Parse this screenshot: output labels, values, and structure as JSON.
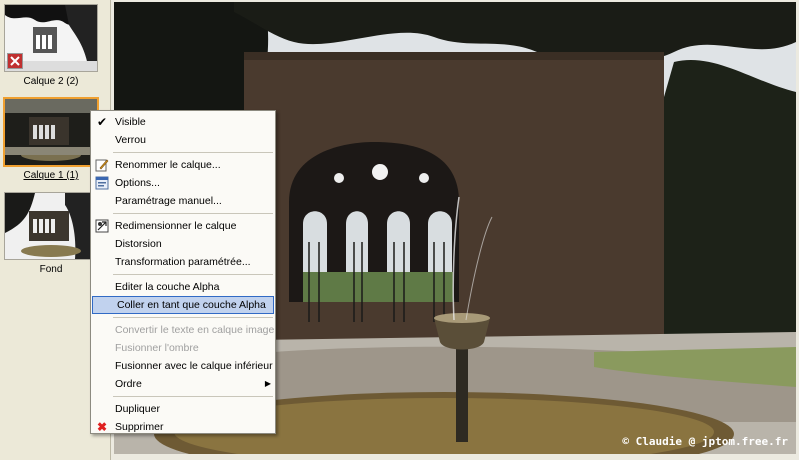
{
  "layers": [
    {
      "label": "Calque 2 (2)"
    },
    {
      "label": "Calque 1 (1)"
    },
    {
      "label": "Fond"
    }
  ],
  "context_menu": {
    "items": [
      {
        "label": "Visible",
        "icon": "checkmark-icon",
        "enabled": true
      },
      {
        "label": "Verrou",
        "enabled": true
      },
      {
        "label": "Renommer le calque...",
        "icon": "rename-icon",
        "enabled": true
      },
      {
        "label": "Options...",
        "icon": "options-icon",
        "enabled": true
      },
      {
        "label": "Paramétrage manuel...",
        "enabled": true
      },
      {
        "label": "Redimensionner le calque",
        "icon": "resize-icon",
        "enabled": true
      },
      {
        "label": "Distorsion",
        "enabled": true
      },
      {
        "label": "Transformation paramétrée...",
        "enabled": true
      },
      {
        "label": "Editer la couche Alpha",
        "enabled": true
      },
      {
        "label": "Coller en tant que couche Alpha",
        "enabled": true,
        "highlighted": true
      },
      {
        "label": "Convertir le texte en calque image",
        "enabled": false
      },
      {
        "label": "Fusionner l'ombre",
        "enabled": false
      },
      {
        "label": "Fusionner avec le calque inférieur",
        "enabled": true
      },
      {
        "label": "Ordre",
        "enabled": true,
        "submenu": true
      },
      {
        "label": "Dupliquer",
        "enabled": true
      },
      {
        "label": "Supprimer",
        "icon": "delete-x-icon",
        "enabled": true
      }
    ]
  },
  "canvas": {
    "watermark": "© Claudie @ jptom.free.fr"
  },
  "colors": {
    "selection_border": "#f0a030",
    "menu_highlight": "#c1d2ee",
    "menu_highlight_border": "#316ac5",
    "delete_red": "#e02020"
  }
}
